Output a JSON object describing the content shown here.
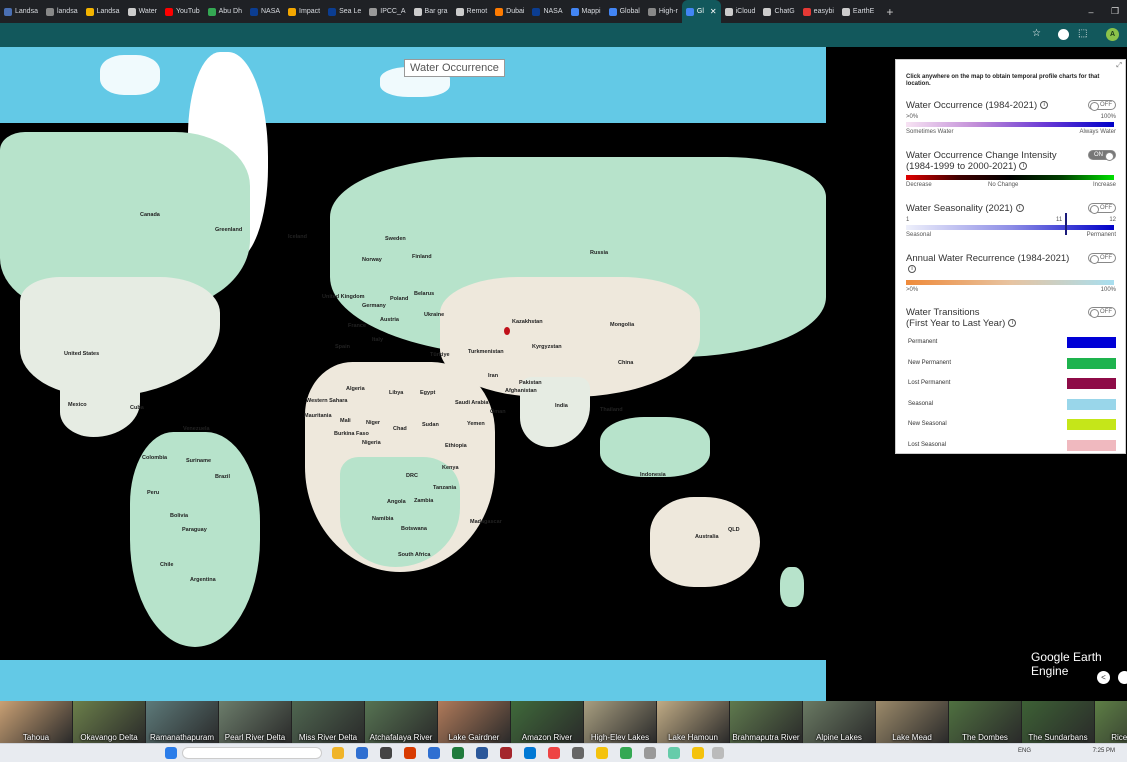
{
  "browser": {
    "tabs": [
      {
        "label": "Landsa",
        "color": "#4a6fb3"
      },
      {
        "label": "landsa",
        "color": "#888888"
      },
      {
        "label": "Landsa",
        "color": "#f4b400"
      },
      {
        "label": "Water",
        "color": "#cccccc"
      },
      {
        "label": "YouTub",
        "color": "#ff0000"
      },
      {
        "label": "Abu Dh",
        "color": "#34a853"
      },
      {
        "label": "NASA",
        "color": "#0b3d91"
      },
      {
        "label": "Impact",
        "color": "#f4a700"
      },
      {
        "label": "Sea Le",
        "color": "#0b3d91"
      },
      {
        "label": "IPCC_A",
        "color": "#999999"
      },
      {
        "label": "Bar gra",
        "color": "#cccccc"
      },
      {
        "label": "Remot",
        "color": "#cccccc"
      },
      {
        "label": "Dubai",
        "color": "#ff7b00"
      },
      {
        "label": "NASA",
        "color": "#0b3d91"
      },
      {
        "label": "Mappi",
        "color": "#4285f4"
      },
      {
        "label": "Global",
        "color": "#4285f4"
      },
      {
        "label": "High-r",
        "color": "#888888"
      },
      {
        "label": "Gl",
        "color": "#4285f4",
        "active": true
      },
      {
        "label": "iCloud",
        "color": "#cccccc"
      },
      {
        "label": "ChatG",
        "color": "#cccccc"
      },
      {
        "label": "easybi",
        "color": "#e53935"
      },
      {
        "label": "EarthE",
        "color": "#cccccc"
      }
    ],
    "active_close": "✕",
    "new_tab": "+",
    "window_controls": [
      "–",
      "❐"
    ],
    "profile_initial": "A"
  },
  "map": {
    "title": "Water Occurrence",
    "labels": [
      {
        "name": "Greenland"
      },
      {
        "name": "Iceland"
      },
      {
        "name": "Sweden"
      },
      {
        "name": "Norway"
      },
      {
        "name": "Finland"
      },
      {
        "name": "Russia"
      },
      {
        "name": "United Kingdom"
      },
      {
        "name": "Poland"
      },
      {
        "name": "Belarus"
      },
      {
        "name": "Germany"
      },
      {
        "name": "France"
      },
      {
        "name": "Austria"
      },
      {
        "name": "Ukraine"
      },
      {
        "name": "Kazakhstan"
      },
      {
        "name": "Mongolia"
      },
      {
        "name": "Spain"
      },
      {
        "name": "Italy"
      },
      {
        "name": "Türkiye"
      },
      {
        "name": "Turkmenistan"
      },
      {
        "name": "Kyrgyzstan"
      },
      {
        "name": "China"
      },
      {
        "name": "Iran"
      },
      {
        "name": "Afghanistan"
      },
      {
        "name": "Pakistan"
      },
      {
        "name": "Algeria"
      },
      {
        "name": "Libya"
      },
      {
        "name": "Egypt"
      },
      {
        "name": "Saudi Arabia"
      },
      {
        "name": "Oman"
      },
      {
        "name": "Yemen"
      },
      {
        "name": "India"
      },
      {
        "name": "Western Sahara"
      },
      {
        "name": "Mauritania"
      },
      {
        "name": "Mali"
      },
      {
        "name": "Niger"
      },
      {
        "name": "Chad"
      },
      {
        "name": "Sudan"
      },
      {
        "name": "Burkina Faso"
      },
      {
        "name": "Nigeria"
      },
      {
        "name": "Ethiopia"
      },
      {
        "name": "Kenya"
      },
      {
        "name": "DRC"
      },
      {
        "name": "Tanzania"
      },
      {
        "name": "Angola"
      },
      {
        "name": "Zambia"
      },
      {
        "name": "Namibia"
      },
      {
        "name": "Botswana"
      },
      {
        "name": "Madagascar"
      },
      {
        "name": "South Africa"
      },
      {
        "name": "Canada"
      },
      {
        "name": "United States"
      },
      {
        "name": "Mexico"
      },
      {
        "name": "Cuba"
      },
      {
        "name": "Venezuela"
      },
      {
        "name": "Colombia"
      },
      {
        "name": "Suriname"
      },
      {
        "name": "Peru"
      },
      {
        "name": "Brazil"
      },
      {
        "name": "Bolivia"
      },
      {
        "name": "Paraguay"
      },
      {
        "name": "Chile"
      },
      {
        "name": "Argentina"
      },
      {
        "name": "Indonesia"
      },
      {
        "name": "Australia"
      },
      {
        "name": "QLD"
      },
      {
        "name": "Thailand"
      }
    ]
  },
  "panel": {
    "intro": "Click anywhere on the map to obtain temporal profile charts for that location.",
    "info_icon": "i",
    "layers": [
      {
        "title": "Water Occurrence (1984-2021)",
        "toggle": "OFF",
        "top_left": ">0%",
        "top_right": "100%",
        "bottom_left": "Sometimes Water",
        "bottom_right": "Always Water"
      },
      {
        "title_line1": "Water Occurrence Change Intensity",
        "title_line2": "(1984-1999 to 2000-2021)",
        "toggle": "ON",
        "left": "Decrease",
        "mid": "No Change",
        "right": "Increase"
      },
      {
        "title": "Water Seasonality (2021)",
        "toggle": "OFF",
        "top_left": "1",
        "marker": "11",
        "top_right": "12",
        "bottom_left": "Seasonal",
        "bottom_right": "Permanent"
      },
      {
        "title": "Annual Water Recurrence (1984-2021)",
        "toggle": "OFF",
        "bottom_left": ">0%",
        "bottom_right": "100%"
      },
      {
        "title_line1": "Water Transitions",
        "title_line2": "(First Year to Last Year)",
        "toggle": "OFF"
      }
    ],
    "transitions": [
      {
        "label": "Permanent",
        "color": "#0000d6"
      },
      {
        "label": "New Permanent",
        "color": "#1eb34e"
      },
      {
        "label": "Lost Permanent",
        "color": "#8e0b47"
      },
      {
        "label": "Seasonal",
        "color": "#99d6ea"
      },
      {
        "label": "New Seasonal",
        "color": "#c5e619"
      },
      {
        "label": "Lost Seasonal",
        "color": "#f0b9bf"
      }
    ]
  },
  "branding": "Google Earth Engine",
  "share_icon": "<",
  "thumbnails": [
    {
      "label": "Tahoua",
      "color": "#c9a074"
    },
    {
      "label": "Okavango Delta",
      "color": "#6b7f4a"
    },
    {
      "label": "Ramanathapuram",
      "color": "#5d7a7a"
    },
    {
      "label": "Pearl River Delta",
      "color": "#6c7d6b"
    },
    {
      "label": "Miss River Delta",
      "color": "#4f6650"
    },
    {
      "label": "Atchafalaya River",
      "color": "#567352"
    },
    {
      "label": "Lake Gairdner",
      "color": "#b07a5a"
    },
    {
      "label": "Amazon River",
      "color": "#3f6a3a"
    },
    {
      "label": "High-Elev Lakes",
      "color": "#a89e80"
    },
    {
      "label": "Lake Hamoun",
      "color": "#c0ab85"
    },
    {
      "label": "Brahmaputra River",
      "color": "#5f7a4e"
    },
    {
      "label": "Alpine Lakes",
      "color": "#6a7a63"
    },
    {
      "label": "Lake Mead",
      "color": "#9c8a6a"
    },
    {
      "label": "The Dombes",
      "color": "#4f7040"
    },
    {
      "label": "The Sundarbans",
      "color": "#3d6135"
    },
    {
      "label": "Rice Fields",
      "color": "#5d7e45"
    }
  ],
  "taskbar": {
    "lang": "ENG",
    "clock": "7:25 PM"
  }
}
